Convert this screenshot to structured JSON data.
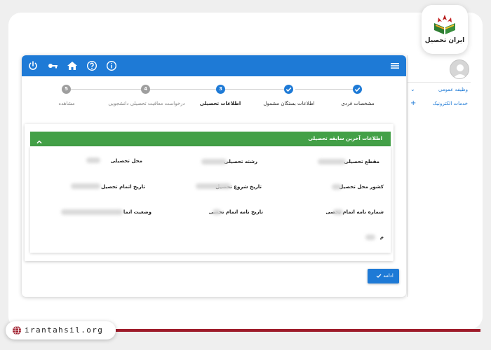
{
  "brand": {
    "logo_text": "ایران تحصیل",
    "website": "irantahsil.org"
  },
  "sidebar": {
    "items": [
      {
        "label": "وظیفه عمومی",
        "icon": "chevron-down-icon"
      },
      {
        "label": "خدمات الکترونیک",
        "icon": "plus-icon"
      }
    ]
  },
  "stepper": {
    "steps": [
      {
        "label": "مشخصات فردی",
        "state": "done",
        "number": "1"
      },
      {
        "label": "اطلاعات بستگان مشمول",
        "state": "done",
        "number": "2"
      },
      {
        "label": "اطلاعات تحصیلی",
        "state": "active",
        "number": "3"
      },
      {
        "label": "درخواست معافیت تحصیلی دانشجویی",
        "state": "todo",
        "number": "4"
      },
      {
        "label": "مشاهده",
        "state": "todo",
        "number": "5"
      }
    ]
  },
  "section": {
    "title": "اطلاعات آخرین سابقه تحصیلی",
    "fields": {
      "maghta": "مقطع تحصیلی",
      "reshte": "رشته تحصیلی",
      "mahal": "محل تحصیلی",
      "keshvar": "کشور محل تحصیل",
      "shoro": "تاریخ شروع تحصیل",
      "etmam": "تاریخ اتمام تحصیل",
      "shomare_name": "شماره نامه اتمام تحصی",
      "tarikh_name": "تاریخ نامه اتمام تحصی",
      "vazeiat": "وضعیت اتما",
      "extra": "م"
    }
  },
  "actions": {
    "continue_label": "ادامه"
  },
  "colors": {
    "primary": "#1e7ad6",
    "section_header": "#43a047",
    "accent_red": "#9e1b2a"
  }
}
